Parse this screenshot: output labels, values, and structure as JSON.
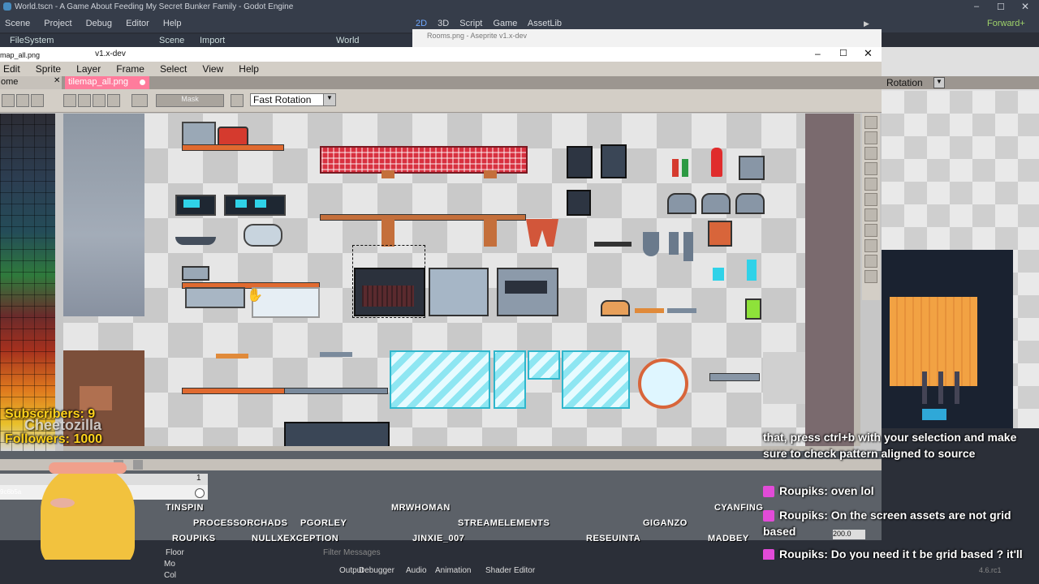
{
  "godot": {
    "title": "World.tscn - A Game About Feeding My Secret Bunker Family - Godot Engine",
    "menu": [
      "Scene",
      "Project",
      "Debug",
      "Editor",
      "Help"
    ],
    "workspaces": [
      "2D",
      "3D",
      "Script",
      "Game",
      "AssetLib"
    ],
    "renderer": "Forward+",
    "dock_tabs": [
      "FileSystem",
      "Scene",
      "Import"
    ],
    "scene_tab": "World",
    "right_select": "Rotation",
    "bottom_tabs": [
      "Output",
      "Debugger",
      "Audio",
      "Animation",
      "Shader Editor"
    ],
    "filter_placeholder": "Filter Messages",
    "tree_items": [
      "Floor",
      "Mo",
      "Col"
    ],
    "version": "4.6.rc1"
  },
  "aseprite2": {
    "title": "Rooms.png - Aseprite v1.x-dev"
  },
  "aseprite": {
    "title": "tilemap_all.png - Aseprite v1.x-dev",
    "title_prefix": "map_all.png",
    "menu": [
      "Edit",
      "Sprite",
      "Layer",
      "Frame",
      "Select",
      "View",
      "Help"
    ],
    "tab_home": "ome",
    "tab_file": "tilemap_all.png",
    "mask_label": "Mask",
    "rotation_select": "Fast Rotation",
    "layer_label": "yer",
    "frame_number": "1",
    "hex_color": "9c6b5a",
    "zoom": "200.0"
  },
  "stream": {
    "subscribers": "Subscribers: 9",
    "followers": "Followers: 1000",
    "streamer_name": "Cheetozilla",
    "credits": [
      {
        "name": "TINSPIN"
      },
      {
        "name": "MRWHOMAN"
      },
      {
        "name": "CYANFING"
      },
      {
        "name": "PROCESSORCHADS"
      },
      {
        "name": "PGORLEY"
      },
      {
        "name": "STREAMELEMENTS"
      },
      {
        "name": "GIGANZO"
      },
      {
        "name": "ROUPIKS"
      },
      {
        "name": "NULLXEXCEPTION"
      },
      {
        "name": "JINXIE_007"
      },
      {
        "name": "RESEUINTA"
      },
      {
        "name": "MADBEY"
      }
    ],
    "chat": [
      {
        "user": "",
        "text": "that, press ctrl+b with your selection and make sure to check pattern aligned to source"
      },
      {
        "user": "Roupiks:",
        "text": "oven lol"
      },
      {
        "user": "Roupiks:",
        "text": "On the screen assets are not grid based"
      },
      {
        "user": "Roupiks:",
        "text": "Do you need it t be grid based ? it'll just be a background"
      }
    ]
  },
  "colors": {
    "godot_bg": "#363d4a",
    "aseprite_chrome": "#d3cec6",
    "tablecloth": "#d8303f",
    "glass": "#8ee6f2",
    "chat_heart": "#e24bd8",
    "subscriber_text": "#ffd21a"
  }
}
